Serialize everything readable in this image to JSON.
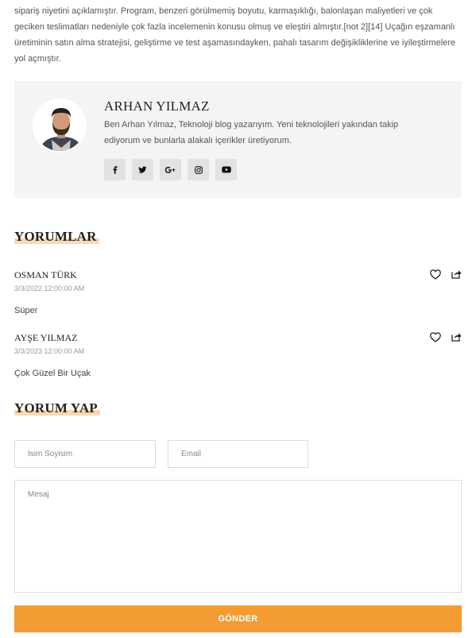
{
  "article": {
    "paragraph": "sipariş niyetini açıklamıştır. Program, benzeri görülmemiş boyutu, karmaşıklığı, balonlaşan maliyetleri ve çok geciken teslimatları nedeniyle çok fazla incelemenin konusu olmuş ve eleştiri almıştır.[not 2][14] Uçağın eşzamanlı üretiminin satın alma stratejisi, geliştirme ve test aşamasındayken, pahalı tasarım değişikliklerine ve iyileştirmelere yol açmıştır."
  },
  "author": {
    "name": "ARHAN YILMAZ",
    "bio": "Ben Arhan Yılmaz, Teknoloji blog yazarıyım. Yeni teknolojileri yakından takip ediyorum ve bunlarla alakalı içerikler üretiyorum.",
    "socials": [
      "facebook-icon",
      "twitter-icon",
      "google-plus-icon",
      "instagram-icon",
      "youtube-icon"
    ]
  },
  "comments": {
    "title": "YORUMLAR",
    "items": [
      {
        "name": "OSMAN TÜRK",
        "date": "3/3/2022 12:00:00 AM",
        "text": "Süper"
      },
      {
        "name": "AYŞE YILMAZ",
        "date": "3/3/2023 12:00:00 AM",
        "text": "Çok Güzel Bir Uçak"
      }
    ]
  },
  "form": {
    "title": "YORUM YAP",
    "name_placeholder": "İsim Soyisim",
    "email_placeholder": "Email",
    "message_placeholder": "Mesaj",
    "submit_label": "GÖNDER"
  },
  "colors": {
    "accent": "#f39c33",
    "highlight": "#fbd8b4",
    "author_bg": "#f4f4f4"
  }
}
